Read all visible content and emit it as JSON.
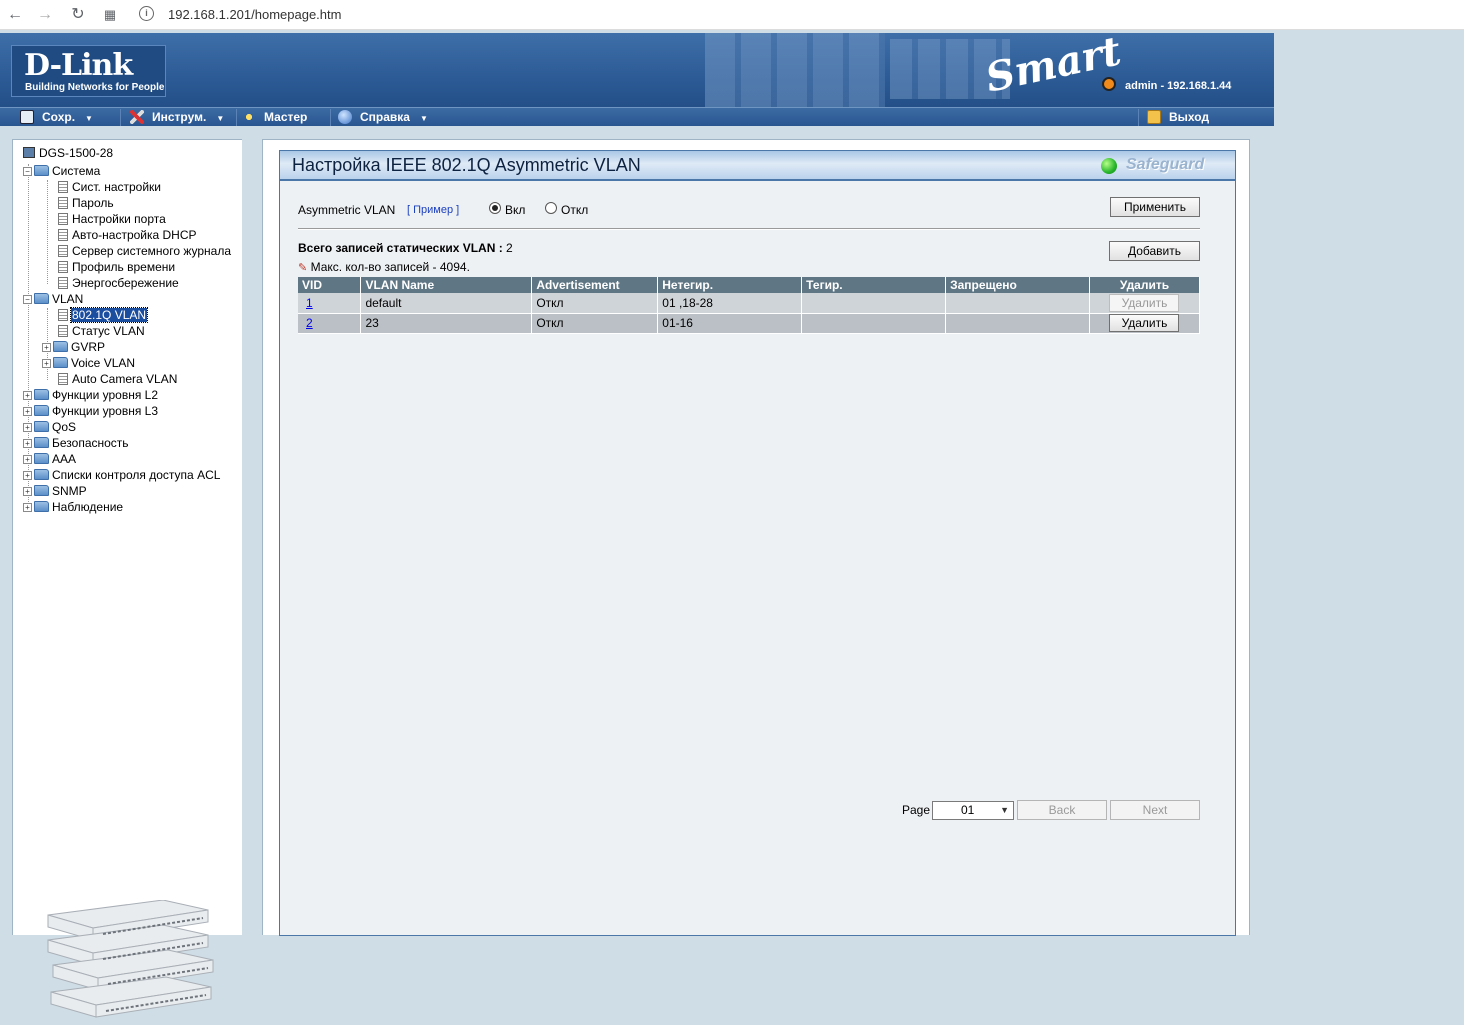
{
  "browser": {
    "url": "192.168.1.201/homepage.htm"
  },
  "header": {
    "logo": "D-Link",
    "logo_tagline": "Building Networks for People",
    "product_logo": "Smart",
    "user_info": "admin - 192.168.1.44"
  },
  "menu": {
    "save": "Сохр.",
    "tools": "Инструм.",
    "wizard": "Мастер",
    "help": "Справка",
    "logout": "Выход"
  },
  "tree": {
    "root": "DGS-1500-28",
    "system": "Система",
    "system_items": [
      "Сист. настройки",
      "Пароль",
      "Настройки порта",
      "Авто-настройка DHCP",
      "Сервер системного журнала",
      "Профиль времени",
      "Энергосбережение"
    ],
    "vlan": "VLAN",
    "vlan_item_selected": "802.1Q VLAN",
    "vlan_status": "Статус VLAN",
    "gvrp": "GVRP",
    "voice_vlan": "Voice VLAN",
    "auto_camera_vlan": "Auto Camera VLAN",
    "top_folders": [
      "Функции уровня L2",
      "Функции уровня L3",
      "QoS",
      "Безопасность",
      "AAA",
      "Списки контроля доступа ACL",
      "SNMP",
      "Наблюдение"
    ]
  },
  "page": {
    "title": "Настройка IEEE 802.1Q Asymmetric VLAN",
    "safeguard": "Safeguard",
    "asym_label": "Asymmetric VLAN",
    "example_link": "[ Пример ]",
    "radio_on": "Вкл",
    "radio_off": "Откл",
    "radio_selected": "on",
    "apply": "Применить",
    "total_label": "Всего записей статических VLAN :",
    "total_value": "2",
    "max_note": "Макс. кол-во записей - 4094.",
    "add": "Добавить"
  },
  "table": {
    "headers": [
      "VID",
      "VLAN Name",
      "Advertisement",
      "Нетегир.",
      "Тегир.",
      "Запрещено",
      "Удалить"
    ],
    "rows": [
      {
        "vid": "1",
        "name": "default",
        "adv": "Откл",
        "untagged": "01 ,18-28",
        "tagged": "",
        "forbidden": "",
        "delete": "Удалить",
        "delete_disabled": true
      },
      {
        "vid": "2",
        "name": "23",
        "adv": "Откл",
        "untagged": "01-16",
        "tagged": "",
        "forbidden": "",
        "delete": "Удалить",
        "delete_disabled": false
      }
    ]
  },
  "pagination": {
    "label": "Page",
    "current": "01",
    "back": "Back",
    "next": "Next"
  },
  "colors": {
    "header_blue": "#2c5b95",
    "table_header": "#5f7685",
    "selected_tree": "#1c4ea0"
  }
}
